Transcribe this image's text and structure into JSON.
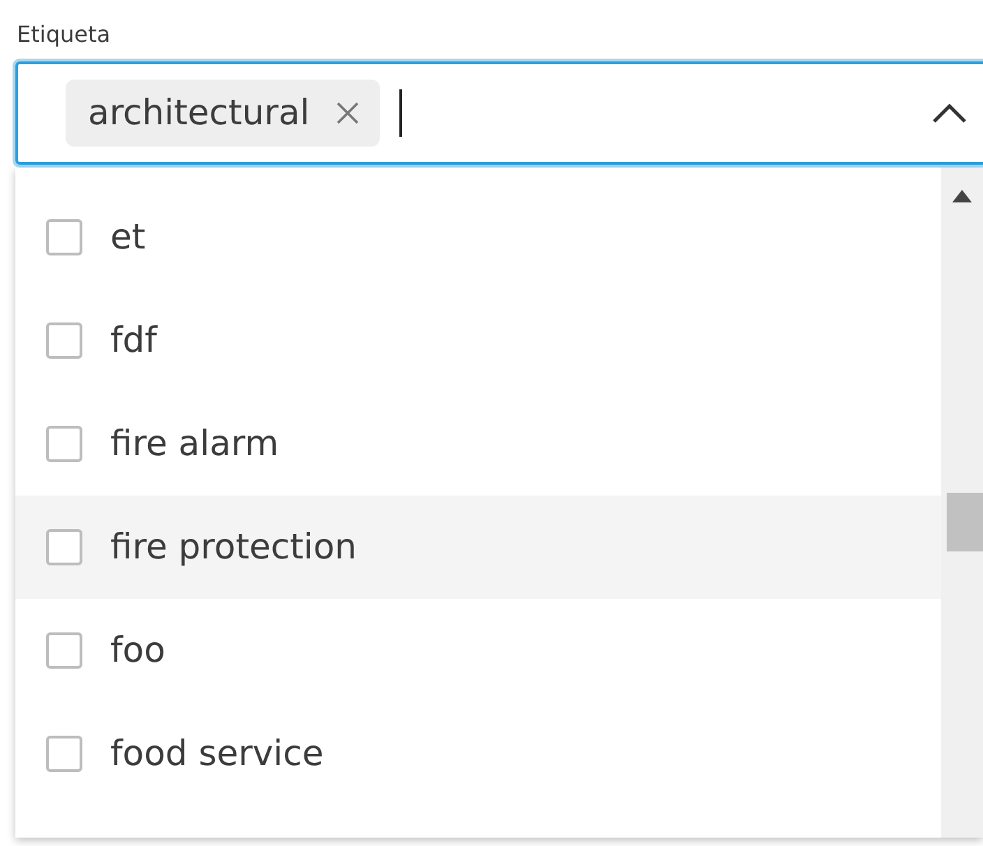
{
  "field": {
    "label": "Etiqueta",
    "focused": true,
    "expanded": true,
    "chips": [
      {
        "label": "architectural"
      }
    ]
  },
  "options": [
    {
      "label": "et",
      "checked": false,
      "highlighted": false
    },
    {
      "label": "fdf",
      "checked": false,
      "highlighted": false
    },
    {
      "label": "fire alarm",
      "checked": false,
      "highlighted": false
    },
    {
      "label": "fire protection",
      "checked": false,
      "highlighted": true
    },
    {
      "label": "foo",
      "checked": false,
      "highlighted": false
    },
    {
      "label": "food service",
      "checked": false,
      "highlighted": false
    }
  ]
}
